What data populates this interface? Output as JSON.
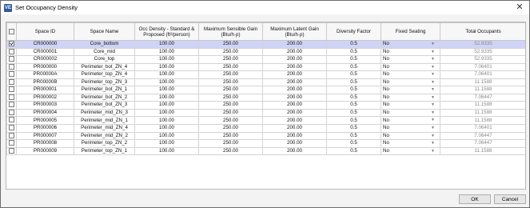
{
  "window": {
    "title": "Set Occupancy Density",
    "app_icon": "VE",
    "close_glyph": "✕"
  },
  "table": {
    "columns": [
      "",
      "Space ID",
      "Space Name",
      "Occ Density - Standard & Proposed (ft²/person)",
      "Maximum Sensible Gain (Btu/h·p)",
      "Maximum Latent Gain (Btu/h·p)",
      "Diversity Factor",
      "Fixed Seating",
      "Total Occupants"
    ],
    "rows": [
      {
        "checked": true,
        "id": "CR000000",
        "name": "Core_bottom",
        "density": "100.00",
        "sensible": "250.00",
        "latent": "200.00",
        "diversity": "0.5",
        "seating": "No",
        "occupants": "52.9335"
      },
      {
        "checked": false,
        "id": "CR000001",
        "name": "Core_mid",
        "density": "100.00",
        "sensible": "250.00",
        "latent": "200.00",
        "diversity": "0.5",
        "seating": "No",
        "occupants": "52.9335"
      },
      {
        "checked": false,
        "id": "CR000002",
        "name": "Core_top",
        "density": "100.00",
        "sensible": "250.00",
        "latent": "200.00",
        "diversity": "0.5",
        "seating": "No",
        "occupants": "52.9335"
      },
      {
        "checked": false,
        "id": "PR000000",
        "name": "Perimeter_bot_ZN_4",
        "density": "100.00",
        "sensible": "250.00",
        "latent": "200.00",
        "diversity": "0.5",
        "seating": "No",
        "occupants": "7.06401"
      },
      {
        "checked": false,
        "id": "PR00000A",
        "name": "Perimeter_top_ZN_4",
        "density": "100.00",
        "sensible": "250.00",
        "latent": "200.00",
        "diversity": "0.5",
        "seating": "No",
        "occupants": "7.06401"
      },
      {
        "checked": false,
        "id": "PR00000B",
        "name": "Perimeter_top_ZN_3",
        "density": "100.00",
        "sensible": "250.00",
        "latent": "200.00",
        "diversity": "0.5",
        "seating": "No",
        "occupants": "11.1588"
      },
      {
        "checked": false,
        "id": "PR000001",
        "name": "Perimeter_bot_ZN_1",
        "density": "100.00",
        "sensible": "250.00",
        "latent": "200.00",
        "diversity": "0.5",
        "seating": "No",
        "occupants": "11.1588"
      },
      {
        "checked": false,
        "id": "PR000002",
        "name": "Perimeter_bot_ZN_2",
        "density": "100.00",
        "sensible": "250.00",
        "latent": "200.00",
        "diversity": "0.5",
        "seating": "No",
        "occupants": "7.06447"
      },
      {
        "checked": false,
        "id": "PR000003",
        "name": "Perimeter_bot_ZN_3",
        "density": "100.00",
        "sensible": "250.00",
        "latent": "200.00",
        "diversity": "0.5",
        "seating": "No",
        "occupants": "11.1588"
      },
      {
        "checked": false,
        "id": "PR000004",
        "name": "Perimeter_mid_ZN_3",
        "density": "100.00",
        "sensible": "250.00",
        "latent": "200.00",
        "diversity": "0.5",
        "seating": "No",
        "occupants": "11.1588"
      },
      {
        "checked": false,
        "id": "PR000005",
        "name": "Perimeter_mid_ZN_1",
        "density": "100.00",
        "sensible": "250.00",
        "latent": "200.00",
        "diversity": "0.5",
        "seating": "No",
        "occupants": "11.1588"
      },
      {
        "checked": false,
        "id": "PR000006",
        "name": "Perimeter_mid_ZN_4",
        "density": "100.00",
        "sensible": "250.00",
        "latent": "200.00",
        "diversity": "0.5",
        "seating": "No",
        "occupants": "7.06401"
      },
      {
        "checked": false,
        "id": "PR000007",
        "name": "Perimeter_mid_ZN_2",
        "density": "100.00",
        "sensible": "250.00",
        "latent": "200.00",
        "diversity": "0.5",
        "seating": "No",
        "occupants": "7.06447"
      },
      {
        "checked": false,
        "id": "PR000008",
        "name": "Perimeter_top_ZN_2",
        "density": "100.00",
        "sensible": "250.00",
        "latent": "200.00",
        "diversity": "0.5",
        "seating": "No",
        "occupants": "7.06447"
      },
      {
        "checked": false,
        "id": "PR000009",
        "name": "Perimeter_top_ZN_1",
        "density": "100.00",
        "sensible": "250.00",
        "latent": "200.00",
        "diversity": "0.5",
        "seating": "No",
        "occupants": "11.1588"
      }
    ]
  },
  "buttons": {
    "ok": "OK",
    "cancel": "Cancel"
  },
  "colors": {
    "selected_row": "#cfd3f5",
    "occupants_text": "#8a8a8a",
    "app_icon": "#2d5b9a"
  }
}
